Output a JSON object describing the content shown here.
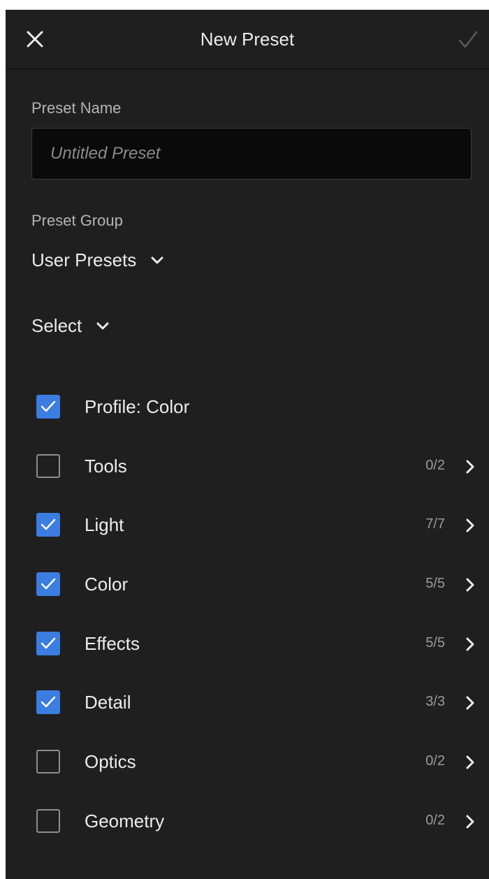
{
  "header": {
    "title": "New Preset",
    "close_icon": "close-icon",
    "confirm_icon": "checkmark-icon"
  },
  "preset_name": {
    "label": "Preset Name",
    "value": "",
    "placeholder": "Untitled Preset"
  },
  "preset_group": {
    "label": "Preset Group",
    "selected": "User Presets"
  },
  "select": {
    "label": "Select"
  },
  "colors": {
    "background": "#1f1f1f",
    "checkbox_checked": "#3b7de0",
    "text": "#ececec",
    "muted": "#9a9a9a"
  },
  "settings": [
    {
      "label": "Profile: Color",
      "checked": true,
      "count": "",
      "expandable": false
    },
    {
      "label": "Tools",
      "checked": false,
      "count": "0/2",
      "expandable": true
    },
    {
      "label": "Light",
      "checked": true,
      "count": "7/7",
      "expandable": true
    },
    {
      "label": "Color",
      "checked": true,
      "count": "5/5",
      "expandable": true
    },
    {
      "label": "Effects",
      "checked": true,
      "count": "5/5",
      "expandable": true
    },
    {
      "label": "Detail",
      "checked": true,
      "count": "3/3",
      "expandable": true
    },
    {
      "label": "Optics",
      "checked": false,
      "count": "0/2",
      "expandable": true
    },
    {
      "label": "Geometry",
      "checked": false,
      "count": "0/2",
      "expandable": true
    }
  ]
}
